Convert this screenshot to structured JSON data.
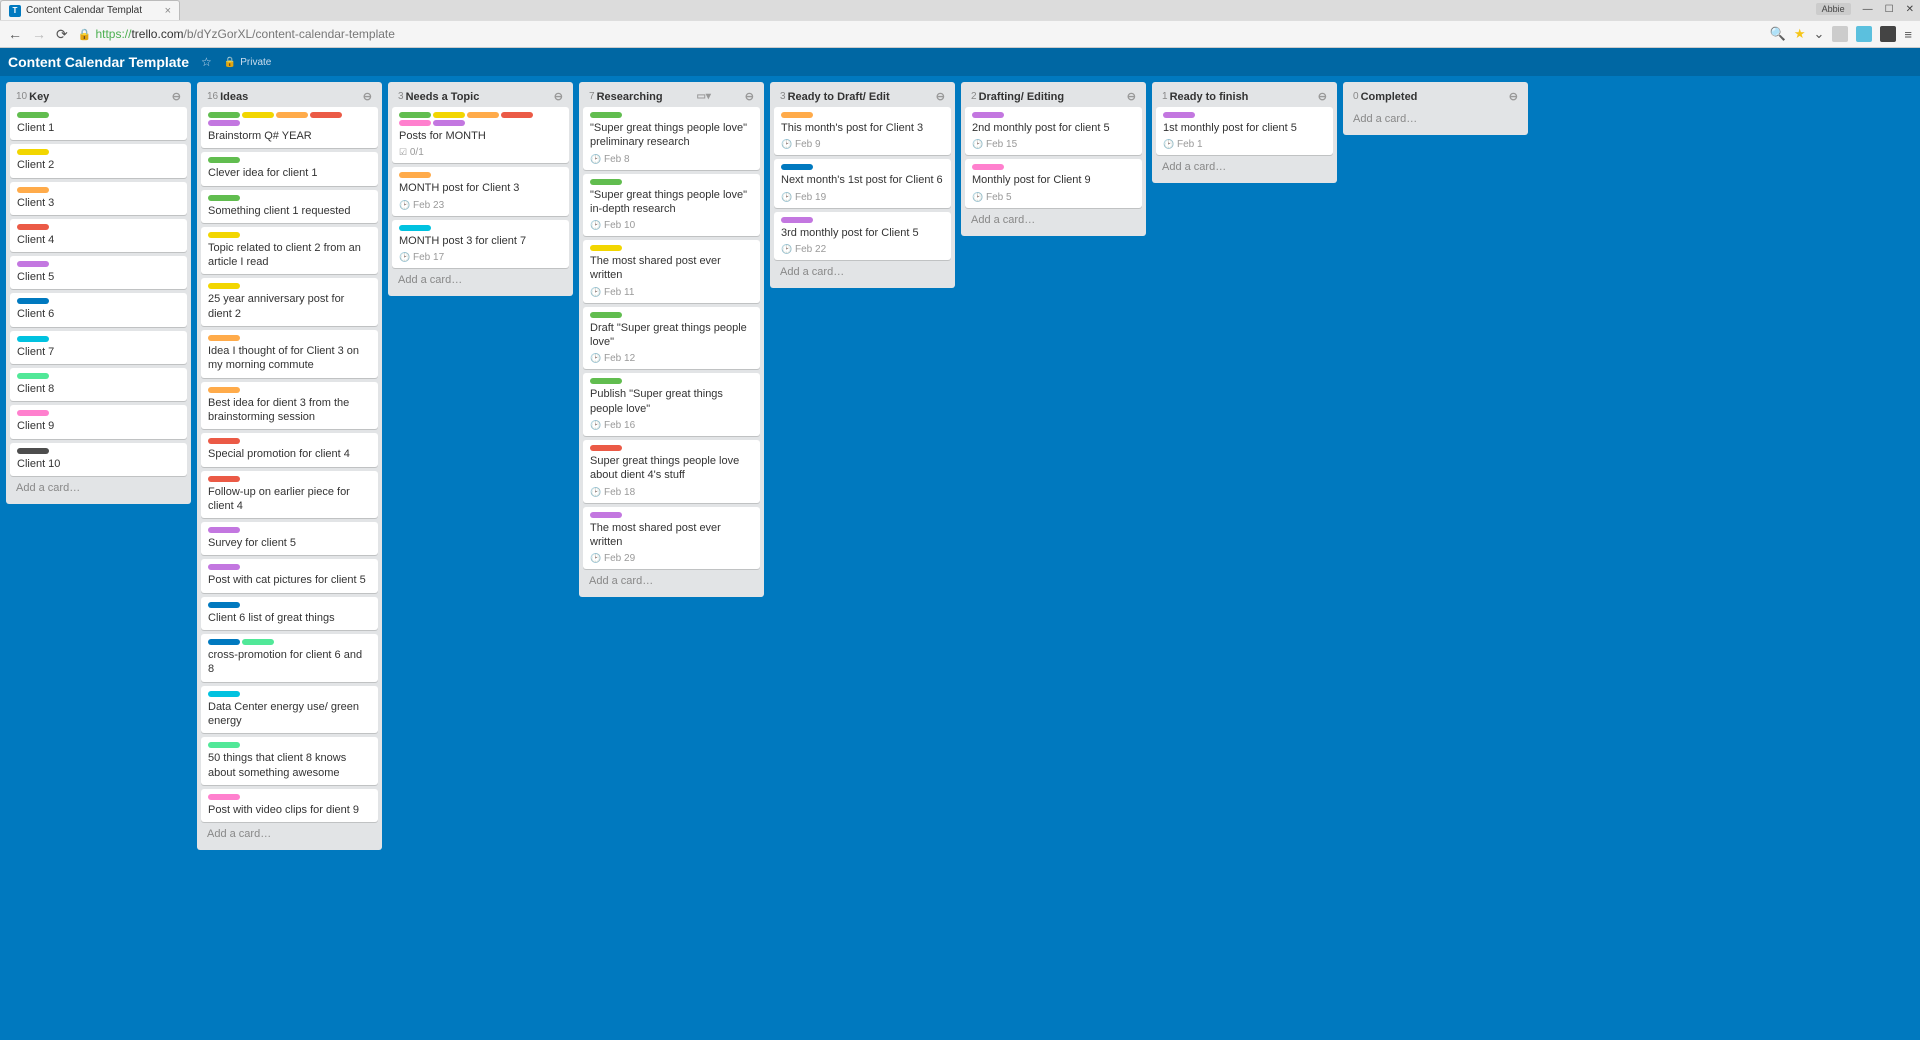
{
  "browser": {
    "tab_title": "Content Calendar Templat",
    "user_chip": "Abbie",
    "url_proto": "https://",
    "url_host": "trello.com",
    "url_path": "/b/dYzGorXL/content-calendar-template"
  },
  "board": {
    "title": "Content Calendar Template",
    "visibility": "Private"
  },
  "add_card_text": "Add a card…",
  "checklist_text": "0/1",
  "lists": [
    {
      "count": "10",
      "title": "Key",
      "cards": [
        {
          "labels": [
            "green"
          ],
          "title": "Client 1"
        },
        {
          "labels": [
            "yellow"
          ],
          "title": "Client 2"
        },
        {
          "labels": [
            "orange"
          ],
          "title": "Client 3"
        },
        {
          "labels": [
            "red"
          ],
          "title": "Client 4"
        },
        {
          "labels": [
            "purple"
          ],
          "title": "Client 5"
        },
        {
          "labels": [
            "blue"
          ],
          "title": "Client 6"
        },
        {
          "labels": [
            "sky"
          ],
          "title": "Client 7"
        },
        {
          "labels": [
            "lime"
          ],
          "title": "Client 8"
        },
        {
          "labels": [
            "pink"
          ],
          "title": "Client 9"
        },
        {
          "labels": [
            "black"
          ],
          "title": "Client 10"
        }
      ]
    },
    {
      "count": "16",
      "title": "Ideas",
      "cards": [
        {
          "labels": [
            "green",
            "yellow",
            "orange",
            "red",
            "purple"
          ],
          "title": "Brainstorm Q# YEAR"
        },
        {
          "labels": [
            "green"
          ],
          "title": "Clever idea for client 1"
        },
        {
          "labels": [
            "green"
          ],
          "title": "Something client 1 requested"
        },
        {
          "labels": [
            "yellow"
          ],
          "title": "Topic related to client 2 from an article I read"
        },
        {
          "labels": [
            "yellow"
          ],
          "title": "25 year anniversary post for dient 2"
        },
        {
          "labels": [
            "orange"
          ],
          "title": "Idea I thought of for Client 3 on my morning commute"
        },
        {
          "labels": [
            "orange"
          ],
          "title": "Best idea for dient 3 from the brainstorming session"
        },
        {
          "labels": [
            "red"
          ],
          "title": "Special promotion for client 4"
        },
        {
          "labels": [
            "red"
          ],
          "title": "Follow-up on earlier piece for client 4"
        },
        {
          "labels": [
            "purple"
          ],
          "title": "Survey for client 5"
        },
        {
          "labels": [
            "purple"
          ],
          "title": "Post with cat pictures for client 5"
        },
        {
          "labels": [
            "blue"
          ],
          "title": "Client 6 list of great things"
        },
        {
          "labels": [
            "blue",
            "lime"
          ],
          "title": "cross-promotion for client 6 and 8"
        },
        {
          "labels": [
            "sky"
          ],
          "title": "Data Center energy use/ green energy"
        },
        {
          "labels": [
            "lime"
          ],
          "title": "50 things that client 8 knows about something awesome"
        },
        {
          "labels": [
            "pink"
          ],
          "title": "Post with video clips for dient 9"
        }
      ]
    },
    {
      "count": "3",
      "title": "Needs a Topic",
      "cards": [
        {
          "labels": [
            "green",
            "yellow",
            "orange",
            "red",
            "pink",
            "purple"
          ],
          "title": "Posts for MONTH",
          "checklist": true
        },
        {
          "labels": [
            "orange"
          ],
          "title": "MONTH post for Client 3",
          "due": "Feb  23"
        },
        {
          "labels": [
            "sky"
          ],
          "title": "MONTH post 3 for client 7",
          "due": "Feb  17"
        }
      ]
    },
    {
      "count": "7",
      "title": "Researching",
      "header_extra": true,
      "cards": [
        {
          "labels": [
            "green"
          ],
          "title": "\"Super great things people love\" preliminary research",
          "due": "Feb  8"
        },
        {
          "labels": [
            "green"
          ],
          "title": "\"Super great things people love\" in-depth research",
          "due": "Feb  10"
        },
        {
          "labels": [
            "yellow"
          ],
          "title": "The most shared post ever written",
          "due": "Feb  11"
        },
        {
          "labels": [
            "green"
          ],
          "title": "Draft \"Super great things people love\"",
          "due": "Feb  12"
        },
        {
          "labels": [
            "green"
          ],
          "title": "Publish \"Super great things people love\"",
          "due": "Feb  16"
        },
        {
          "labels": [
            "red"
          ],
          "title": "Super great things people love about dient 4's stuff",
          "due": "Feb  18"
        },
        {
          "labels": [
            "purple"
          ],
          "title": "The most shared post ever written",
          "due": "Feb  29"
        }
      ]
    },
    {
      "count": "3",
      "title": "Ready to Draft/ Edit",
      "cards": [
        {
          "labels": [
            "orange"
          ],
          "title": "This month's post for Client 3",
          "due": "Feb  9"
        },
        {
          "labels": [
            "blue"
          ],
          "title": "Next month's 1st post for Client 6",
          "due": "Feb  19"
        },
        {
          "labels": [
            "purple"
          ],
          "title": "3rd monthly post for Client 5",
          "due": "Feb  22"
        }
      ]
    },
    {
      "count": "2",
      "title": "Drafting/ Editing",
      "cards": [
        {
          "labels": [
            "purple"
          ],
          "title": "2nd monthly post for client 5",
          "due": "Feb  15"
        },
        {
          "labels": [
            "pink"
          ],
          "title": "Monthly post for Client 9",
          "due": "Feb  5"
        }
      ]
    },
    {
      "count": "1",
      "title": "Ready to finish",
      "cards": [
        {
          "labels": [
            "purple"
          ],
          "title": "1st monthly post for client 5",
          "due": "Feb  1"
        }
      ]
    },
    {
      "count": "0",
      "title": "Completed",
      "cards": []
    }
  ]
}
